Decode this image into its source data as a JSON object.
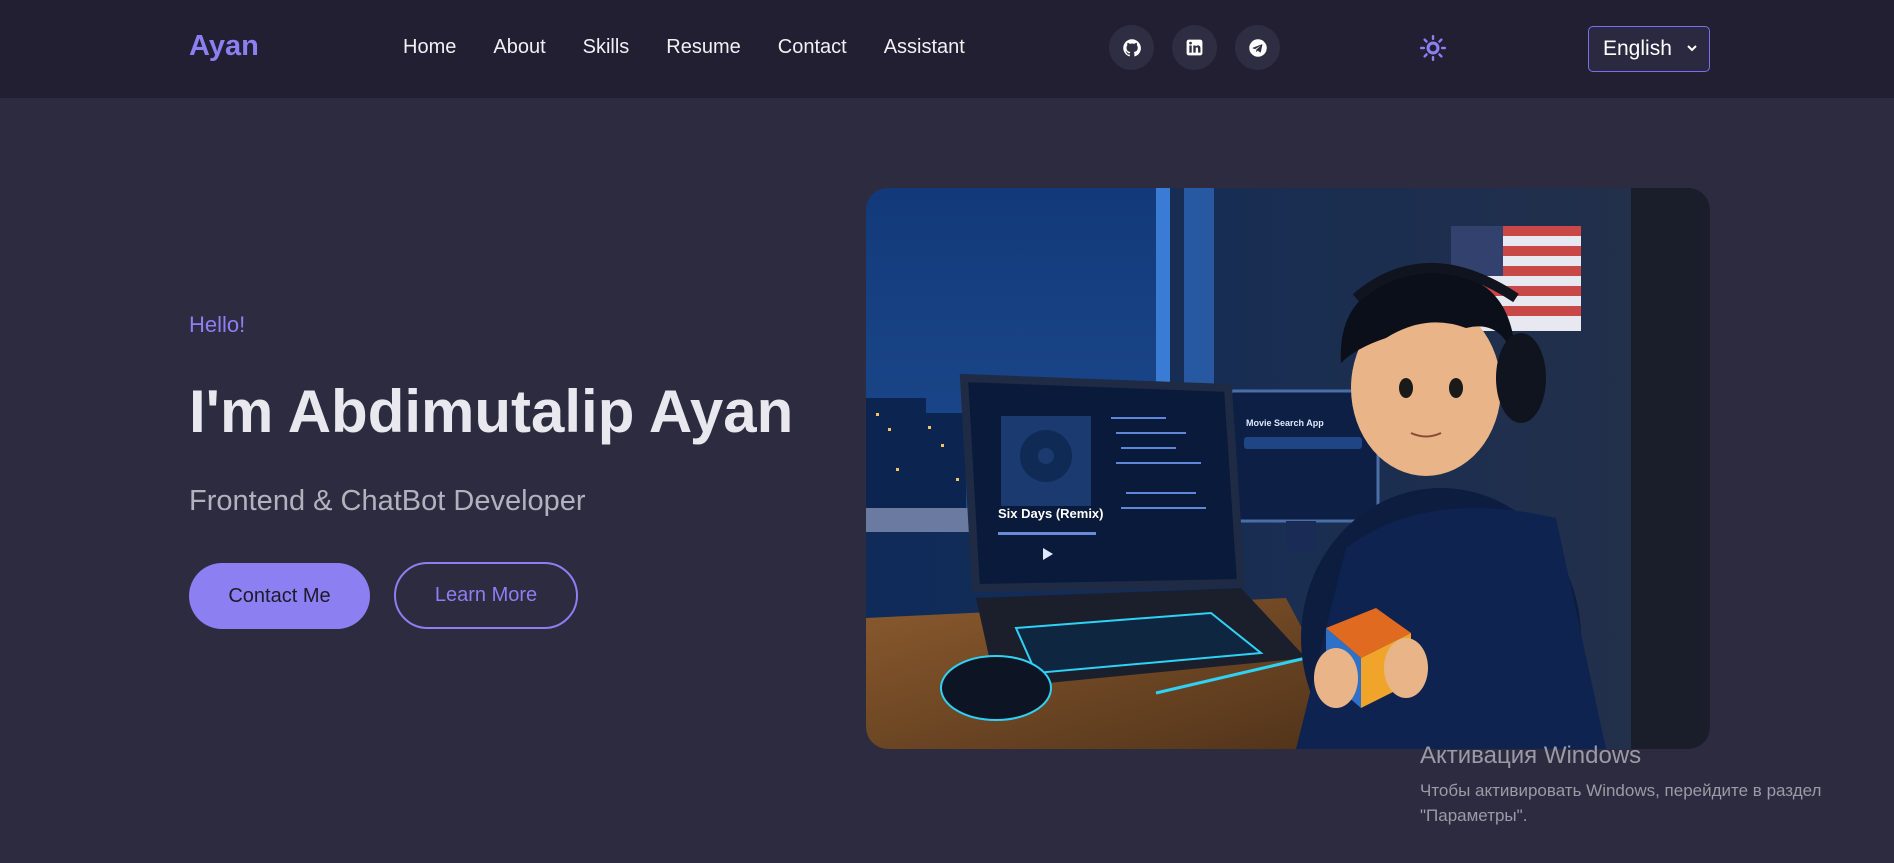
{
  "header": {
    "logo": "Ayan",
    "nav": [
      "Home",
      "About",
      "Skills",
      "Resume",
      "Contact",
      "Assistant"
    ],
    "socials": [
      "github-icon",
      "linkedin-icon",
      "telegram-icon"
    ],
    "theme_icon": "sun-icon",
    "language": "English"
  },
  "hero": {
    "greeting": "Hello!",
    "title": "I'm Abdimutalip Ayan",
    "subtitle": "Frontend & ChatBot Developer",
    "contact_button": "Contact Me",
    "learn_button": "Learn More"
  },
  "illustration": {
    "music_track": "Six Days (Remix)",
    "app_title": "Movie Search App"
  },
  "watermark": {
    "title": "Активация Windows",
    "text": "Чтобы активировать Windows, перейдите в раздел \"Параметры\"."
  },
  "colors": {
    "accent": "#8b7ff2",
    "background": "#2d2b3f",
    "header": "#211f31"
  }
}
